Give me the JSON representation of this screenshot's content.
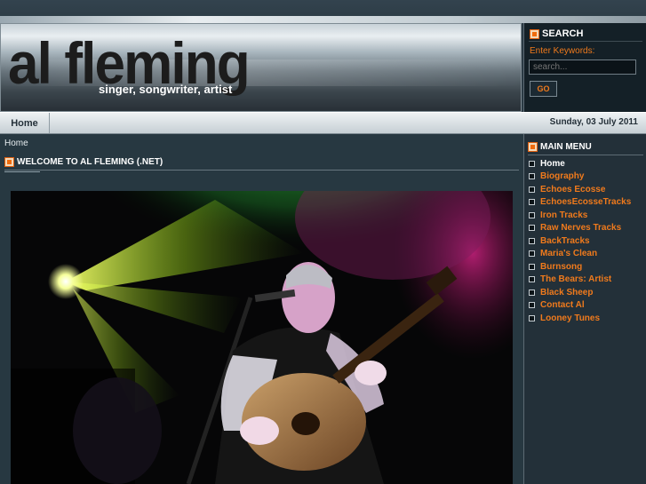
{
  "header": {
    "title": "al fleming",
    "tagline": "singer, songwriter, artist"
  },
  "search": {
    "title": "SEARCH",
    "label": "Enter Keywords:",
    "placeholder": "search...",
    "button_label": "GO"
  },
  "navbar": {
    "home_label": "Home",
    "date": "Sunday, 03 July 2011"
  },
  "content": {
    "breadcrumb": "Home",
    "article_title": "WELCOME TO AL FLEMING (.NET)"
  },
  "menu": {
    "title": "MAIN MENU",
    "items": [
      {
        "label": "Home",
        "active": true
      },
      {
        "label": "Biography"
      },
      {
        "label": "Echoes Ecosse"
      },
      {
        "label": "EchoesEcosseTracks"
      },
      {
        "label": "Iron Tracks"
      },
      {
        "label": "Raw Nerves Tracks"
      },
      {
        "label": "BackTracks"
      },
      {
        "label": "Maria's Clean"
      },
      {
        "label": "Burnsong"
      },
      {
        "label": "The Bears: Artist"
      },
      {
        "label": "Black Sheep"
      },
      {
        "label": "Contact Al"
      },
      {
        "label": "Looney Tunes"
      }
    ]
  },
  "colors": {
    "accent": "#f07a1c",
    "background": "#2b3a44"
  }
}
